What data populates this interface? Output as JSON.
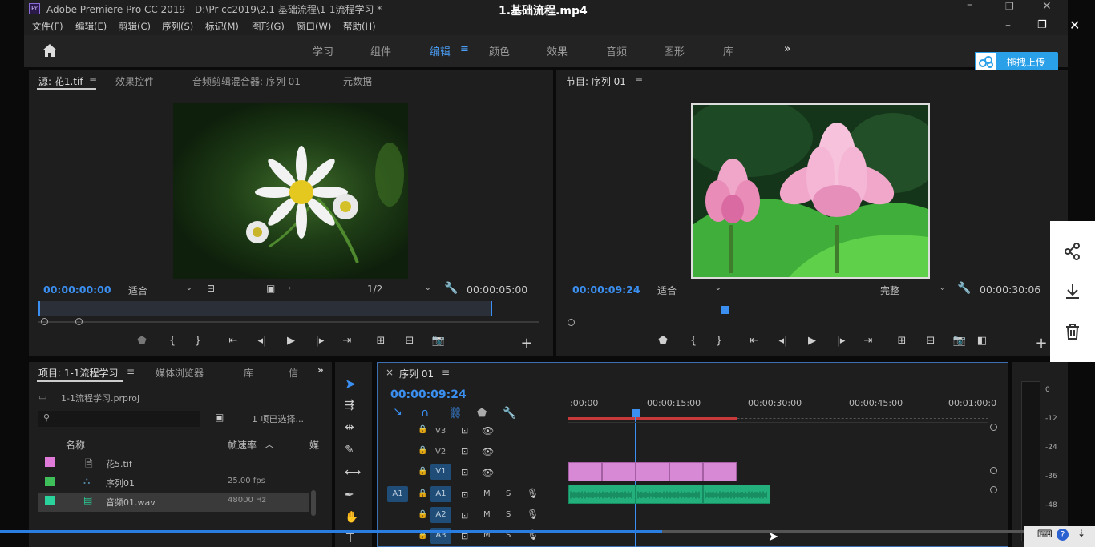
{
  "window": {
    "title": "Adobe Premiere Pro CC 2019 - D:\\Pr cc2019\\2.1 基础流程\\1-1流程学习 *",
    "video_title": "1.基础流程.mp4"
  },
  "menu": [
    "文件(F)",
    "编辑(E)",
    "剪辑(C)",
    "序列(S)",
    "标记(M)",
    "图形(G)",
    "窗口(W)",
    "帮助(H)"
  ],
  "workspaces": [
    "学习",
    "组件",
    "编辑",
    "颜色",
    "效果",
    "音频",
    "图形",
    "库"
  ],
  "active_workspace": "编辑",
  "upload_button": "拖拽上传",
  "source_panel": {
    "tabs": [
      "源: 花1.tif",
      "效果控件",
      "音频剪辑混合器: 序列 01",
      "元数据"
    ],
    "timecode": "00:00:00:00",
    "fit": "适合",
    "resolution": "1/2",
    "duration": "00:00:05:00"
  },
  "program_panel": {
    "tab": "节目: 序列 01",
    "timecode": "00:00:09:24",
    "fit": "适合",
    "quality": "完整",
    "duration": "00:00:30:06"
  },
  "project_panel": {
    "tabs": [
      "项目: 1-1流程学习",
      "媒体浏览器",
      "库",
      "信"
    ],
    "file": "1-1流程学习.prproj",
    "selection": "1 项已选择...",
    "columns": [
      "名称",
      "帧速率",
      "媒"
    ],
    "items": [
      {
        "name": "花5.tif",
        "rate": "",
        "color": "#e07ad8"
      },
      {
        "name": "序列01",
        "rate": "25.00 fps",
        "color": "#3fbf5a"
      },
      {
        "name": "音频01.wav",
        "rate": "48000 Hz",
        "color": "#2ad39b"
      }
    ]
  },
  "timeline": {
    "tab": "序列 01",
    "timecode": "00:00:09:24",
    "ruler": [
      ":00:00",
      "00:00:15:00",
      "00:00:30:00",
      "00:00:45:00",
      "00:01:00:0"
    ],
    "video_tracks": [
      "V3",
      "V2",
      "V1"
    ],
    "audio_tracks": [
      "A1",
      "A2",
      "A3"
    ],
    "source_patch": "A1",
    "track_btn_m": "M",
    "track_btn_s": "S"
  },
  "meter": [
    "0",
    "-12",
    "-24",
    "-36",
    "-48"
  ],
  "player": {
    "progress": 0.605
  }
}
